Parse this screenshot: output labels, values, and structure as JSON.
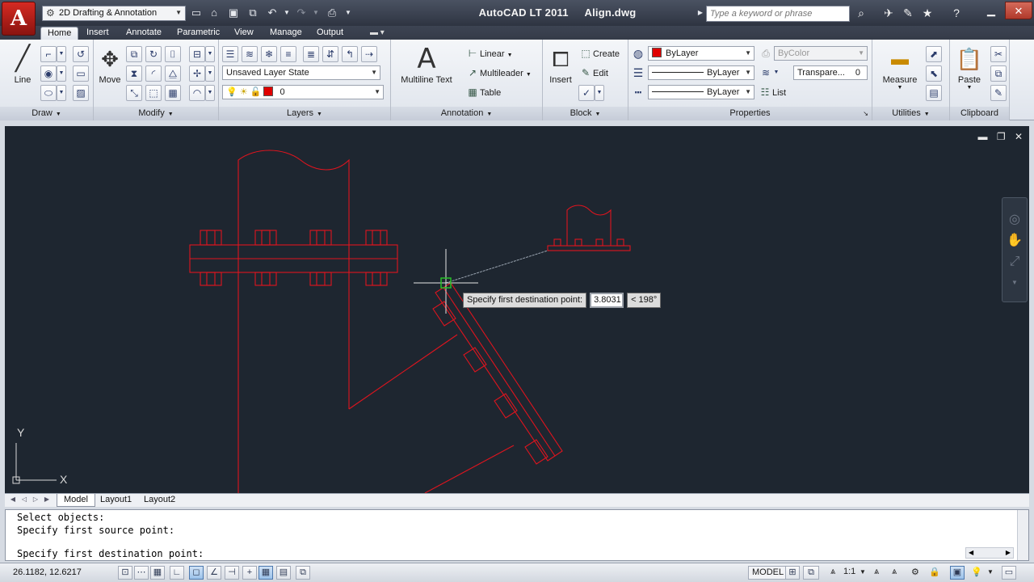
{
  "app": {
    "logo_letter": "A",
    "workspace": "2D Drafting & Annotation",
    "title": "AutoCAD LT 2011",
    "filename": "Align.dwg",
    "search_placeholder": "Type a keyword or phrase"
  },
  "tabs": [
    "Home",
    "Insert",
    "Annotate",
    "Parametric",
    "View",
    "Manage",
    "Output"
  ],
  "ribbon": {
    "draw": {
      "title": "Draw",
      "line_label": "Line"
    },
    "modify": {
      "title": "Modify",
      "move_label": "Move"
    },
    "layers": {
      "title": "Layers",
      "layer_state": "Unsaved Layer State",
      "current_layer": "0"
    },
    "annotation": {
      "title": "Annotation",
      "multiline_text": "Multiline Text",
      "linear": "Linear",
      "multileader": "Multileader",
      "table": "Table"
    },
    "block": {
      "title": "Block",
      "insert": "Insert",
      "create": "Create",
      "edit": "Edit"
    },
    "properties": {
      "title": "Properties",
      "color": "ByLayer",
      "linetype": "ByLayer",
      "lineweight": "ByLayer",
      "plotstyle": "ByColor",
      "transparency": "Transpare...",
      "transparency_value": "0",
      "list": "List"
    },
    "utilities": {
      "title": "Utilities",
      "measure": "Measure"
    },
    "clipboard": {
      "title": "Clipboard",
      "paste": "Paste"
    }
  },
  "viewport": {
    "tooltip_prompt": "Specify first destination point:",
    "tooltip_value": "3.8031",
    "tooltip_angle": "< 198°",
    "ucs_x": "X",
    "ucs_y": "Y"
  },
  "layout_tabs": [
    "Model",
    "Layout1",
    "Layout2"
  ],
  "command_lines": [
    "Select objects:",
    "Specify first source point:",
    "",
    "Specify first destination point:"
  ],
  "status": {
    "coords": "26.1182, 12.6217",
    "model": "MODEL",
    "scale": "1:1"
  },
  "colors": {
    "accent_red": "#e00000",
    "viewport_bg": "#1e2630",
    "drawing_red": "#e0141e"
  }
}
